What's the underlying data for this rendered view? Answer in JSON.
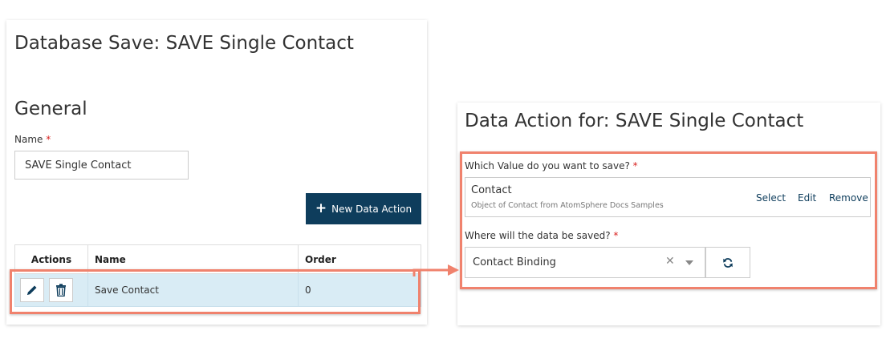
{
  "left_panel": {
    "title": "Database Save: SAVE Single Contact",
    "general_heading": "General",
    "name_label": "Name",
    "required_mark": "*",
    "name_value": "SAVE Single Contact",
    "new_data_action_label": "New Data Action",
    "table": {
      "headers": [
        "Actions",
        "Name",
        "Order"
      ],
      "rows": [
        {
          "name": "Save Contact",
          "order": "0"
        }
      ]
    }
  },
  "right_panel": {
    "title": "Data Action for: SAVE Single Contact",
    "value_label": "Which Value do you want to save?",
    "required_mark": "*",
    "value_name": "Contact",
    "value_description": "Object of Contact from AtomSphere Docs Samples",
    "links": {
      "select": "Select",
      "edit": "Edit",
      "remove": "Remove"
    },
    "where_label": "Where will the data be saved?",
    "binding_value": "Contact Binding"
  },
  "colors": {
    "primary_button": "#0e3d5c",
    "highlight": "#f0826d",
    "selected_row": "#d9ecf5",
    "required": "#d9211e"
  },
  "icons": [
    "plus-icon",
    "pencil-icon",
    "trash-icon",
    "clear-icon",
    "chevron-down-icon",
    "refresh-icon",
    "arrow-icon"
  ]
}
